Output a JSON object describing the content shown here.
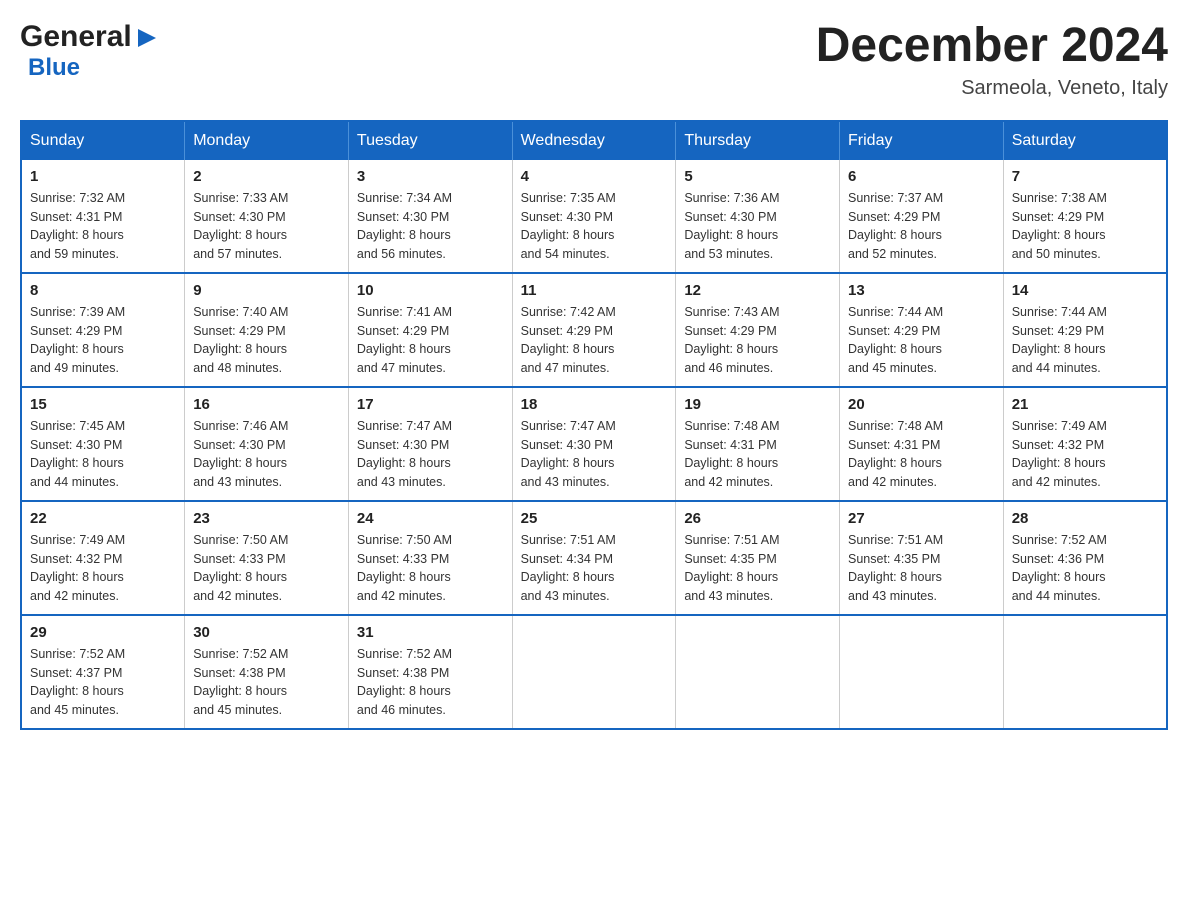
{
  "header": {
    "logo_general": "General",
    "logo_blue": "Blue",
    "month_title": "December 2024",
    "location": "Sarmeola, Veneto, Italy"
  },
  "calendar": {
    "days_of_week": [
      "Sunday",
      "Monday",
      "Tuesday",
      "Wednesday",
      "Thursday",
      "Friday",
      "Saturday"
    ],
    "weeks": [
      [
        {
          "day": "1",
          "sunrise": "7:32 AM",
          "sunset": "4:31 PM",
          "daylight": "8 hours and 59 minutes."
        },
        {
          "day": "2",
          "sunrise": "7:33 AM",
          "sunset": "4:30 PM",
          "daylight": "8 hours and 57 minutes."
        },
        {
          "day": "3",
          "sunrise": "7:34 AM",
          "sunset": "4:30 PM",
          "daylight": "8 hours and 56 minutes."
        },
        {
          "day": "4",
          "sunrise": "7:35 AM",
          "sunset": "4:30 PM",
          "daylight": "8 hours and 54 minutes."
        },
        {
          "day": "5",
          "sunrise": "7:36 AM",
          "sunset": "4:30 PM",
          "daylight": "8 hours and 53 minutes."
        },
        {
          "day": "6",
          "sunrise": "7:37 AM",
          "sunset": "4:29 PM",
          "daylight": "8 hours and 52 minutes."
        },
        {
          "day": "7",
          "sunrise": "7:38 AM",
          "sunset": "4:29 PM",
          "daylight": "8 hours and 50 minutes."
        }
      ],
      [
        {
          "day": "8",
          "sunrise": "7:39 AM",
          "sunset": "4:29 PM",
          "daylight": "8 hours and 49 minutes."
        },
        {
          "day": "9",
          "sunrise": "7:40 AM",
          "sunset": "4:29 PM",
          "daylight": "8 hours and 48 minutes."
        },
        {
          "day": "10",
          "sunrise": "7:41 AM",
          "sunset": "4:29 PM",
          "daylight": "8 hours and 47 minutes."
        },
        {
          "day": "11",
          "sunrise": "7:42 AM",
          "sunset": "4:29 PM",
          "daylight": "8 hours and 47 minutes."
        },
        {
          "day": "12",
          "sunrise": "7:43 AM",
          "sunset": "4:29 PM",
          "daylight": "8 hours and 46 minutes."
        },
        {
          "day": "13",
          "sunrise": "7:44 AM",
          "sunset": "4:29 PM",
          "daylight": "8 hours and 45 minutes."
        },
        {
          "day": "14",
          "sunrise": "7:44 AM",
          "sunset": "4:29 PM",
          "daylight": "8 hours and 44 minutes."
        }
      ],
      [
        {
          "day": "15",
          "sunrise": "7:45 AM",
          "sunset": "4:30 PM",
          "daylight": "8 hours and 44 minutes."
        },
        {
          "day": "16",
          "sunrise": "7:46 AM",
          "sunset": "4:30 PM",
          "daylight": "8 hours and 43 minutes."
        },
        {
          "day": "17",
          "sunrise": "7:47 AM",
          "sunset": "4:30 PM",
          "daylight": "8 hours and 43 minutes."
        },
        {
          "day": "18",
          "sunrise": "7:47 AM",
          "sunset": "4:30 PM",
          "daylight": "8 hours and 43 minutes."
        },
        {
          "day": "19",
          "sunrise": "7:48 AM",
          "sunset": "4:31 PM",
          "daylight": "8 hours and 42 minutes."
        },
        {
          "day": "20",
          "sunrise": "7:48 AM",
          "sunset": "4:31 PM",
          "daylight": "8 hours and 42 minutes."
        },
        {
          "day": "21",
          "sunrise": "7:49 AM",
          "sunset": "4:32 PM",
          "daylight": "8 hours and 42 minutes."
        }
      ],
      [
        {
          "day": "22",
          "sunrise": "7:49 AM",
          "sunset": "4:32 PM",
          "daylight": "8 hours and 42 minutes."
        },
        {
          "day": "23",
          "sunrise": "7:50 AM",
          "sunset": "4:33 PM",
          "daylight": "8 hours and 42 minutes."
        },
        {
          "day": "24",
          "sunrise": "7:50 AM",
          "sunset": "4:33 PM",
          "daylight": "8 hours and 42 minutes."
        },
        {
          "day": "25",
          "sunrise": "7:51 AM",
          "sunset": "4:34 PM",
          "daylight": "8 hours and 43 minutes."
        },
        {
          "day": "26",
          "sunrise": "7:51 AM",
          "sunset": "4:35 PM",
          "daylight": "8 hours and 43 minutes."
        },
        {
          "day": "27",
          "sunrise": "7:51 AM",
          "sunset": "4:35 PM",
          "daylight": "8 hours and 43 minutes."
        },
        {
          "day": "28",
          "sunrise": "7:52 AM",
          "sunset": "4:36 PM",
          "daylight": "8 hours and 44 minutes."
        }
      ],
      [
        {
          "day": "29",
          "sunrise": "7:52 AM",
          "sunset": "4:37 PM",
          "daylight": "8 hours and 45 minutes."
        },
        {
          "day": "30",
          "sunrise": "7:52 AM",
          "sunset": "4:38 PM",
          "daylight": "8 hours and 45 minutes."
        },
        {
          "day": "31",
          "sunrise": "7:52 AM",
          "sunset": "4:38 PM",
          "daylight": "8 hours and 46 minutes."
        },
        null,
        null,
        null,
        null
      ]
    ]
  },
  "labels": {
    "sunrise": "Sunrise: ",
    "sunset": "Sunset: ",
    "daylight": "Daylight: "
  }
}
